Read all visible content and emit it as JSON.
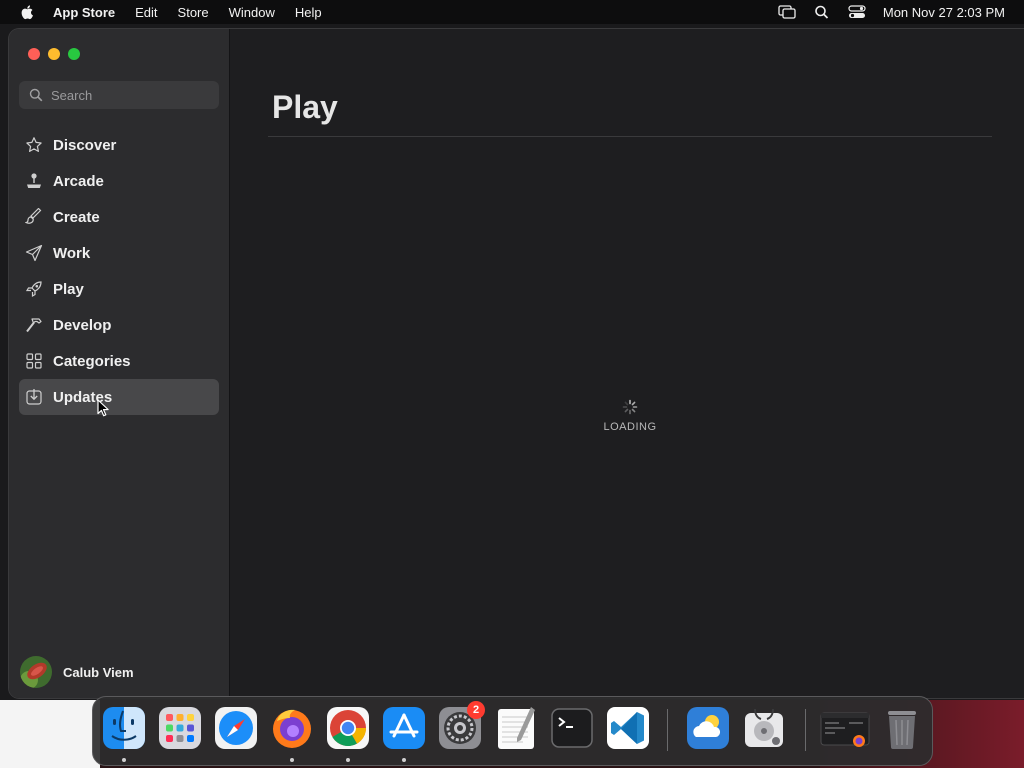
{
  "menubar": {
    "app_name": "App Store",
    "menus": [
      "Edit",
      "Store",
      "Window",
      "Help"
    ],
    "clock": "Mon Nov 27  2:03 PM",
    "status_icons": [
      "screen-mirroring-icon",
      "spotlight-search-icon",
      "control-center-icon"
    ]
  },
  "sidebar": {
    "search_placeholder": "Search",
    "items": [
      {
        "label": "Discover",
        "icon": "star-icon"
      },
      {
        "label": "Arcade",
        "icon": "joystick-icon"
      },
      {
        "label": "Create",
        "icon": "brush-icon"
      },
      {
        "label": "Work",
        "icon": "paper-plane-icon"
      },
      {
        "label": "Play",
        "icon": "rocket-icon"
      },
      {
        "label": "Develop",
        "icon": "hammer-icon"
      },
      {
        "label": "Categories",
        "icon": "grid-icon"
      },
      {
        "label": "Updates",
        "icon": "download-icon"
      }
    ],
    "selected": "Updates",
    "user_name": "Calub Viem"
  },
  "content": {
    "title": "Play",
    "loading_text": "LOADING"
  },
  "dock": {
    "apps": [
      {
        "name": "finder-icon",
        "running": true
      },
      {
        "name": "launchpad-icon",
        "running": false
      },
      {
        "name": "safari-icon",
        "running": false
      },
      {
        "name": "firefox-icon",
        "running": true
      },
      {
        "name": "chrome-icon",
        "running": true
      },
      {
        "name": "app-store-icon",
        "running": true
      },
      {
        "name": "system-settings-icon",
        "running": false,
        "badge": "2"
      },
      {
        "name": "textedit-icon",
        "running": false
      },
      {
        "name": "terminal-icon",
        "running": false
      },
      {
        "name": "vscode-icon",
        "running": false
      },
      {
        "name": "weather-icon",
        "running": false
      },
      {
        "name": "disk-utility-icon",
        "running": false
      },
      {
        "name": "firefox-window-icon",
        "running": false
      },
      {
        "name": "trash-icon",
        "running": false
      }
    ]
  }
}
